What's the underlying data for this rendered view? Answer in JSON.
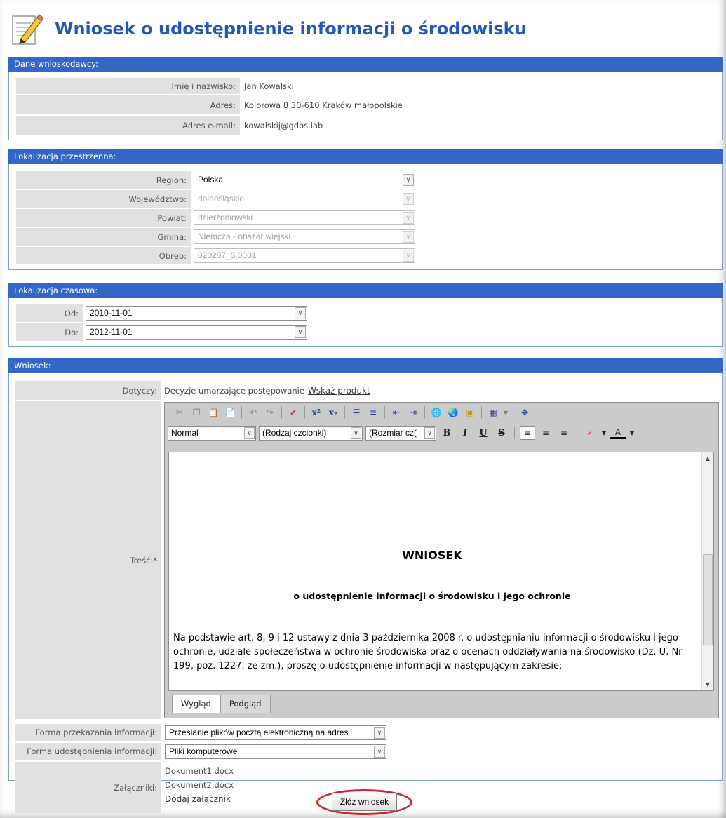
{
  "page_title": "Wniosek o udostępnienie informacji o środowisku",
  "applicant": {
    "header": "Dane wnioskodawcy:",
    "rows": [
      {
        "label": "Imię i nazwisko:",
        "value": "Jan Kowalski"
      },
      {
        "label": "Adres:",
        "value": "Kolorowa 8 30-610 Kraków małopolskie"
      },
      {
        "label": "Adres e-mail:",
        "value": "kowalskij@gdos.lab"
      }
    ]
  },
  "location": {
    "header": "Lokalizacja przestrzenna:",
    "rows": [
      {
        "label": "Region:",
        "value": "Polska",
        "enabled": true
      },
      {
        "label": "Województwo:",
        "value": "dolnośląskie",
        "enabled": false
      },
      {
        "label": "Powiat:",
        "value": "dzierżoniowski",
        "enabled": false
      },
      {
        "label": "Gmina:",
        "value": "Niemcza - obszar wiejski",
        "enabled": false
      },
      {
        "label": "Obręb:",
        "value": "020207_5.0001",
        "enabled": false
      }
    ]
  },
  "time": {
    "header": "Lokalizacja czasowa:",
    "from_label": "Od:",
    "from_value": "2010-11-01",
    "to_label": "Do:",
    "to_value": "2012-11-01"
  },
  "request": {
    "header": "Wniosek:",
    "concerns_label": "Dotyczy:",
    "concerns_value": "Decyzje umarzające postępowanie",
    "concerns_link": "Wskaż produkt",
    "content_label": "Treść:*",
    "editor": {
      "format_select": "Normal",
      "font_select": "(Rodzaj czcionki)",
      "size_select": "(Rozmiar cz(",
      "doc_title": "WNIOSEK",
      "doc_subtitle": "o udostępnienie informacji o środowisku i jego ochronie",
      "doc_para_1": "Na podstawie art. 8, 9 i 12 ustawy z dnia 3 października 2008 r. o udostępnianiu informacji o środowisku i jego",
      "doc_para_2": "ochronie, udziale społeczeństwa w ochronie środowiska oraz o ocenach oddziaływania na środowisko (Dz. U. Nr",
      "doc_para_3": "199, poz. 1227, ze zm.), proszę o udostępnienie informacji w następującym zakresie:",
      "tab_design": "Wygląd",
      "tab_preview": "Podgląd"
    },
    "delivery_label": "Forma przekazania informacji:",
    "delivery_value": "Przesłanie plików pocztą elektroniczną na adres",
    "share_label": "Forma udostępnienia informacji:",
    "share_value": "Pliki komputerowe",
    "attachments_label": "Załączniki:",
    "attachments": [
      "Dokument1.docx",
      "Dokument2.docx"
    ],
    "add_attachment": "Dodaj załącznik"
  },
  "submit_label": "Złóż wniosek",
  "colors": {
    "section_bar": "#3466c5",
    "title": "#2159b4",
    "highlight": "#d2222a"
  }
}
